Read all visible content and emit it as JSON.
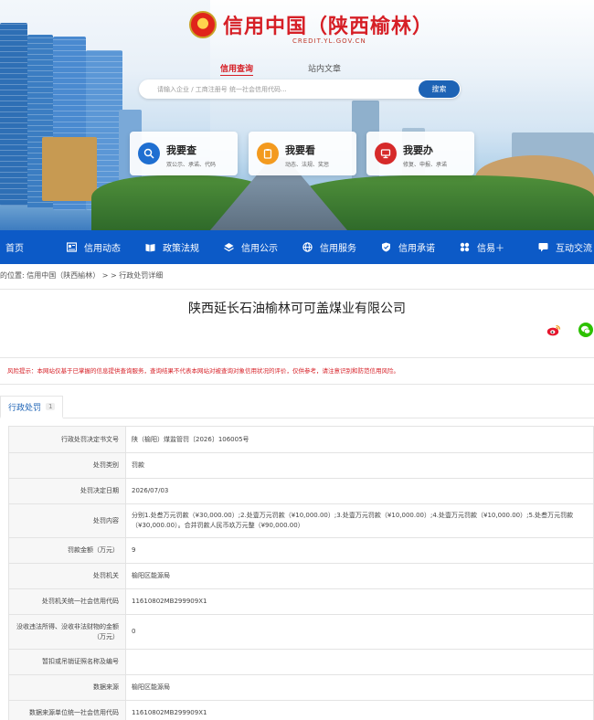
{
  "site": {
    "title": "信用中国（陕西榆林）",
    "domain": "CREDIT.YL.GOV.CN"
  },
  "search": {
    "tabs": [
      {
        "label": "信用查询",
        "active": true
      },
      {
        "label": "站内文章",
        "active": false
      }
    ],
    "placeholder": "请输入企业 / 工商注册号 统一社会信用代码...",
    "button_label": "搜索"
  },
  "quick_cards": [
    {
      "title": "我要查",
      "subtitle": "双公示、承诺、代码",
      "icon": "search-icon",
      "color": "#1f6fd1"
    },
    {
      "title": "我要看",
      "subtitle": "动态、法规、奖惩",
      "icon": "clipboard-icon",
      "color": "#f39a1e"
    },
    {
      "title": "我要办",
      "subtitle": "修复、申报、承诺",
      "icon": "monitor-icon",
      "color": "#d62a2a"
    }
  ],
  "nav": {
    "items": [
      {
        "label": "首页",
        "icon": ""
      },
      {
        "label": "信用动态",
        "icon": "news-icon"
      },
      {
        "label": "政策法规",
        "icon": "book-icon"
      },
      {
        "label": "信用公示",
        "icon": "layers-icon"
      },
      {
        "label": "信用服务",
        "icon": "globe-icon"
      },
      {
        "label": "信用承诺",
        "icon": "shield-icon"
      },
      {
        "label": "信易＋",
        "icon": "apps-icon"
      },
      {
        "label": "互动交流",
        "icon": "chat-icon"
      }
    ],
    "color": "#0c5ac7"
  },
  "breadcrumb": {
    "prefix": "的位置:",
    "home": "信用中国（陕西榆林）",
    "separator": " > > ",
    "current": "行政处罚详细"
  },
  "company_name": "陕西延长石油榆林可可盖煤业有限公司",
  "risk_notice": {
    "label": "风险提示：",
    "text": "本网站仅基于已掌握的信息提供查询服务，查询结果不代表本网站对被查询对象信用状况的评价，仅供参考，请注意识别和防范信用风险。"
  },
  "tab": {
    "label": "行政处罚",
    "count": "1"
  },
  "details": [
    {
      "key": "行政处罚决定书文号",
      "value": "陕（榆阳）煤监管罚〔2026〕106005号"
    },
    {
      "key": "处罚类别",
      "value": "罚款"
    },
    {
      "key": "处罚决定日期",
      "value": "2026/07/03"
    },
    {
      "key": "处罚内容",
      "value": "分别1.处叁万元罚款（¥30,000.00）;2.处壹万元罚款（¥10,000.00）;3.处壹万元罚款（¥10,000.00）;4.处壹万元罚款（¥10,000.00）;5.处叁万元罚款（¥30,000.00）。合并罚款人民币玖万元整（¥90,000.00）"
    },
    {
      "key": "罚款金额（万元）",
      "value": "9"
    },
    {
      "key": "处罚机关",
      "value": "榆阳区能源局"
    },
    {
      "key": "处罚机关统一社会信用代码",
      "value": "11610802MB299909X1"
    },
    {
      "key": "没收违法所得、没收非法财物的金额（万元）",
      "value": "0"
    },
    {
      "key": "暂扣或吊销证照名称及编号",
      "value": ""
    },
    {
      "key": "数据来源",
      "value": "榆阳区能源局"
    },
    {
      "key": "数据来源单位统一社会信用代码",
      "value": "11610802MB299909X1"
    }
  ]
}
